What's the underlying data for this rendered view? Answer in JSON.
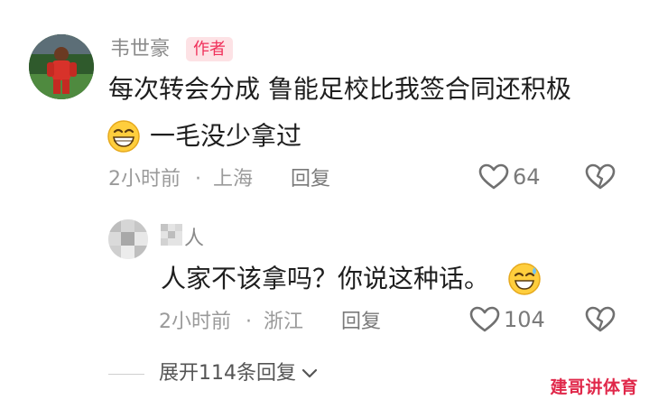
{
  "comment": {
    "author": "韦世豪",
    "badge": "作者",
    "text_line1": "每次转会分成 鲁能足校比我签合同还积极",
    "text_line2": "一毛没少拿过",
    "time": "2小时前",
    "location": "上海",
    "reply_label": "回复",
    "likes": "64"
  },
  "reply": {
    "author": "人",
    "text": "人家不该拿吗？你说这种话。",
    "time": "2小时前",
    "location": "浙江",
    "reply_label": "回复",
    "likes": "104"
  },
  "expand": {
    "label": "展开114条回复"
  },
  "watermark": "建哥讲体育",
  "colors": {
    "badge_text": "#f0305a",
    "badge_bg": "#fde2e5",
    "watermark": "#e0284a"
  }
}
